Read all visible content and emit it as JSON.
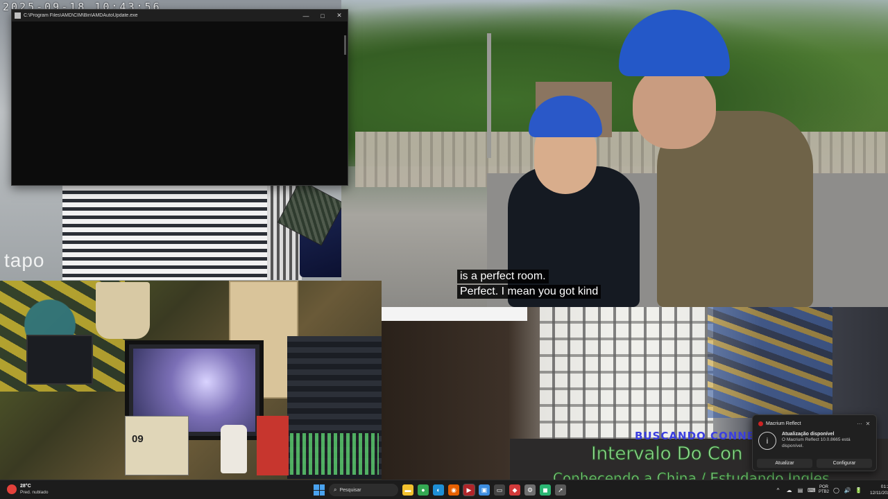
{
  "camera_feeds": {
    "top_left": {
      "timestamp": "2025-09-18 10:43:56",
      "brand": "tapo"
    },
    "top_right": {
      "subtitle_lines": [
        "is a perfect room.",
        "Perfect. I mean you got kind"
      ]
    },
    "bottom_left": {
      "calendar_day": "09"
    },
    "bottom_right": {}
  },
  "overlays": {
    "buscando": "BUSCANDO CONNE",
    "intervalo": "Intervalo Do Con",
    "conhecendo": "Conhecendo a China / Estudando Ingles"
  },
  "console_window": {
    "title": "C:\\Program Files\\AMD\\CIM\\Bin\\AMDAutoUpdate.exe",
    "minimize": "—",
    "maximize": "□",
    "close": "✕"
  },
  "notification": {
    "app": "Macrium Reflect",
    "settings_icon": "···",
    "close_icon": "✕",
    "info_icon": "i",
    "title": "Atualização disponível",
    "text": "O Macrium Reflect 10.0.8665 está disponível.",
    "actions": [
      "Atualizar",
      "Configurar"
    ]
  },
  "taskbar": {
    "weather": {
      "temp": "28°C",
      "desc": "Pred. nublado"
    },
    "search_placeholder": "Pesquisar",
    "search_icon": "⌕",
    "apps": [
      {
        "name": "file-explorer",
        "glyph": "▬",
        "color": "#f2c12e"
      },
      {
        "name": "chrome",
        "glyph": "●",
        "color": "#34a853"
      },
      {
        "name": "edge",
        "glyph": "◐",
        "color": "#1e8fd6"
      },
      {
        "name": "firefox",
        "glyph": "◉",
        "color": "#e66000"
      },
      {
        "name": "video-app",
        "glyph": "▶",
        "color": "#b0252a"
      },
      {
        "name": "photos",
        "glyph": "▣",
        "color": "#3c8de0"
      },
      {
        "name": "terminal",
        "glyph": "▭",
        "color": "#444444"
      },
      {
        "name": "media-player",
        "glyph": "◆",
        "color": "#d23a3a"
      },
      {
        "name": "settings-app",
        "glyph": "⚙",
        "color": "#6f6f6f"
      },
      {
        "name": "green-app",
        "glyph": "◼",
        "color": "#2bb673"
      },
      {
        "name": "arrow-app",
        "glyph": "➚",
        "color": "#5a5a5a"
      }
    ],
    "tray_icons": [
      "^",
      "☁",
      "▤",
      "⌨"
    ],
    "language": [
      "POR",
      "PTB2"
    ],
    "tray_status": [
      "◯",
      "🔊",
      "🔋"
    ],
    "time": "01:23",
    "date": "12/11/2025"
  }
}
